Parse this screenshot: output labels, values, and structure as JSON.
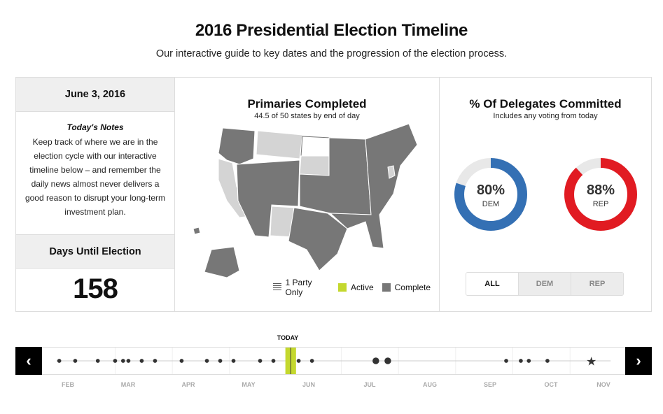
{
  "header": {
    "title": "2016 Presidential Election Timeline",
    "subtitle": "Our interactive guide to key dates and the progression of the election process."
  },
  "sidebar": {
    "date": "June 3, 2016",
    "notes_title": "Today's Notes",
    "notes_body": "Keep track of where we are in the election cycle with our interactive timeline below – and remember the daily news almost never delivers a good reason to disrupt your long-term investment plan.",
    "days_label": "Days Until Election",
    "days_value": "158"
  },
  "primaries": {
    "title": "Primaries Completed",
    "subtitle": "44.5 of 50 states by end of day",
    "legend": [
      {
        "label": "1 Party Only",
        "swatch": "party"
      },
      {
        "label": "Active",
        "swatch": "active"
      },
      {
        "label": "Complete",
        "swatch": "complete"
      }
    ],
    "colors": {
      "complete": "#777777",
      "not_started": "#d4d4d4",
      "active": "#c4d82e"
    }
  },
  "delegates": {
    "title": "% Of Delegates Committed",
    "subtitle": "Includes any voting from today",
    "dem": {
      "pct_text": "80%",
      "label": "DEM",
      "fraction": 0.8,
      "color": "#3470b4"
    },
    "rep": {
      "pct_text": "88%",
      "label": "REP",
      "fraction": 0.88,
      "color": "#e11b22"
    },
    "filters": [
      "ALL",
      "DEM",
      "REP"
    ],
    "selected_filter": "ALL"
  },
  "timeline": {
    "today_label": "TODAY",
    "prev_icon": "chevron-left-icon",
    "next_icon": "chevron-right-icon",
    "months": [
      "FEB",
      "MAR",
      "APR",
      "MAY",
      "JUN",
      "JUL",
      "AUG",
      "SEP",
      "OCT",
      "NOV"
    ],
    "election_icon": "star-icon"
  }
}
